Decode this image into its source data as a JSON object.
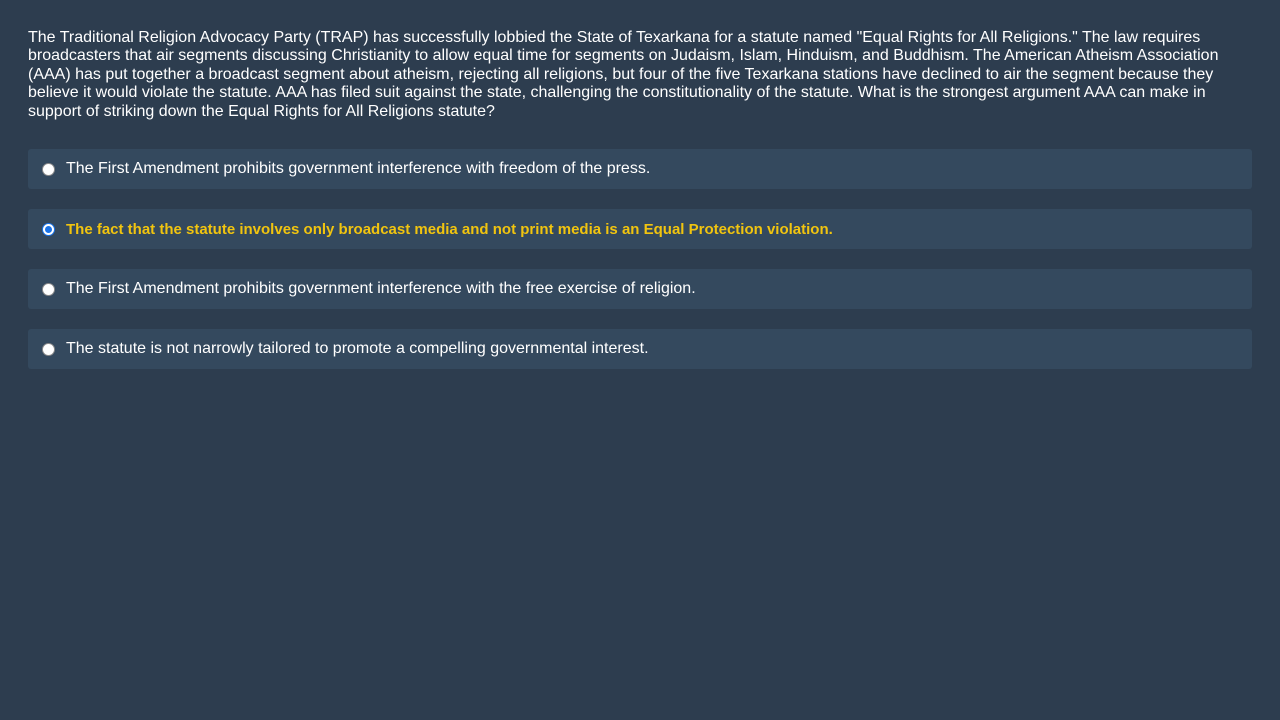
{
  "question": {
    "text": "The Traditional Religion Advocacy Party (TRAP) has successfully lobbied the State of Texarkana for a statute named \"Equal Rights for All Religions.\" The law requires broadcasters that air segments discussing Christianity to allow equal time for segments on Judaism, Islam, Hinduism, and Buddhism. The American Atheism Association (AAA) has put together a broadcast segment about atheism, rejecting all religions, but four of the five Texarkana stations have declined to air the segment because they believe it would violate the statute. AAA has filed suit against the state, challenging the constitutionality of the statute. What is the strongest argument AAA can make in support of striking down the Equal Rights for All Religions statute?"
  },
  "options": [
    {
      "label": "The First Amendment prohibits government interference with freedom of the press.",
      "selected": false
    },
    {
      "label": "The fact that the statute involves only broadcast media and not print media is an Equal Protection violation.",
      "selected": true
    },
    {
      "label": "The First Amendment prohibits government interference with the free exercise of religion.",
      "selected": false
    },
    {
      "label": "The statute is not narrowly tailored to promote a compelling governmental interest.",
      "selected": false
    }
  ],
  "colors": {
    "background": "#2d3d4f",
    "option_background": "#34495e",
    "selected_text": "#f1c40f",
    "radio_checked": "#1a73e8"
  }
}
